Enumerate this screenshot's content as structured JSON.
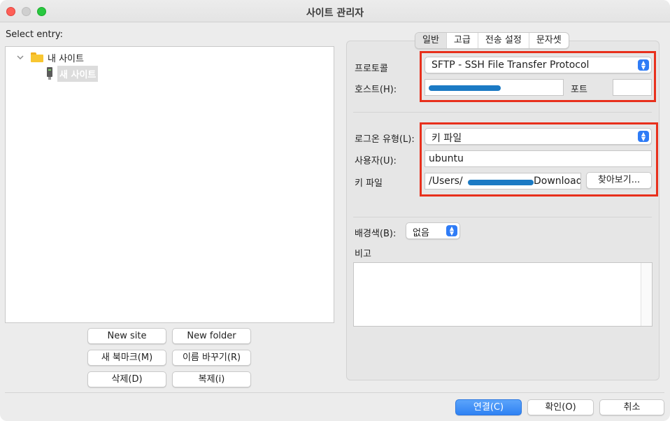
{
  "window": {
    "title": "사이트 관리자"
  },
  "left": {
    "select_entry_label": "Select entry:",
    "tree": {
      "root": {
        "label": "내 사이트"
      },
      "child": {
        "label": "새 사이트"
      }
    },
    "buttons": {
      "new_site": "New site",
      "new_folder": "New folder",
      "new_bookmark": "새 북마크(M)",
      "rename": "이름 바꾸기(R)",
      "delete": "삭제(D)",
      "duplicate": "복제(i)"
    }
  },
  "tabs": [
    {
      "label": "일반"
    },
    {
      "label": "고급"
    },
    {
      "label": "전송 설정"
    },
    {
      "label": "문자셋"
    }
  ],
  "general": {
    "protocol_label": "프로토콜",
    "protocol_value": "SFTP - SSH File Transfer Protocol",
    "host_label": "호스트(H):",
    "host_value": "",
    "port_label": "포트",
    "port_value": "",
    "logon_type_label": "로그온 유형(L):",
    "logon_type_value": "키 파일",
    "user_label": "사용자(U):",
    "user_value": "ubuntu",
    "keyfile_label": "키 파일",
    "keyfile_prefix": "/Users/",
    "keyfile_suffix": "Download",
    "browse_button": "찾아보기...",
    "background_label": "배경색(B):",
    "background_value": "없음",
    "comments_label": "비고"
  },
  "footer": {
    "connect_button": "연결(C)",
    "ok_button": "확인(O)",
    "cancel_button": "취소"
  },
  "colors": {
    "highlight_box": "#e8301c",
    "primary_button": "#2f82f3",
    "redaction": "#1b7ac4"
  },
  "icons": {
    "tree_disclosure": "chevron-down-icon",
    "folder": "folder-icon",
    "site": "server-icon",
    "popup": "updown-chevron-icon"
  }
}
